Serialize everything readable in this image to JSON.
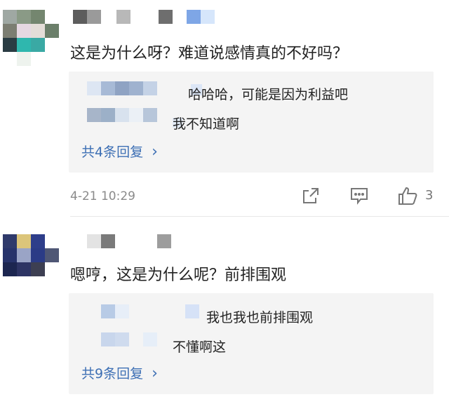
{
  "comments": [
    {
      "text": "这是为什么呀？难道说感情真的不好吗？",
      "replies": [
        {
          "text": "哈哈哈，可能是因为利益吧"
        },
        {
          "text": "我不知道啊"
        }
      ],
      "more_replies": "共4条回复",
      "more_chevron": "›",
      "time": "4-21 10:29",
      "like_count": "3",
      "icons": [
        "share-icon",
        "comment-icon",
        "thumb-up-icon"
      ]
    },
    {
      "text": "嗯哼，这是为什么呢？前排围观",
      "replies": [
        {
          "text": "我也我也前排围观"
        },
        {
          "text": "不懂啊这"
        }
      ],
      "more_replies": "共9条回复",
      "more_chevron": "›"
    }
  ],
  "colors": {
    "link": "#3d6fb4",
    "reply_bg": "#f4f4f4",
    "meta": "#8a8a8a"
  }
}
